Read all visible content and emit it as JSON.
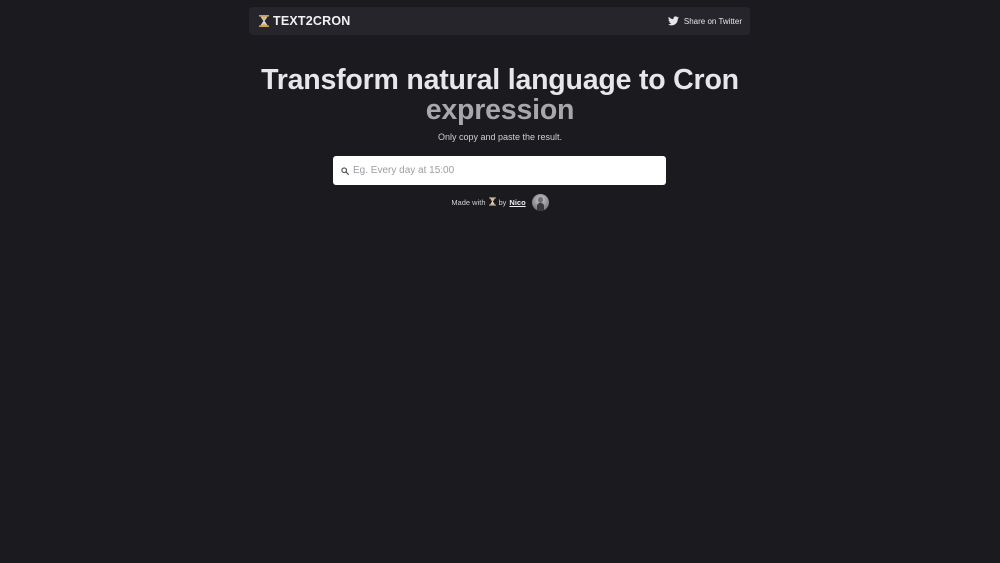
{
  "header": {
    "brand_icon": "hourglass-icon",
    "brand_name": "TEXT2CRON",
    "share_icon": "twitter-icon",
    "share_label": "Share on Twitter"
  },
  "hero": {
    "title_line1": "Transform natural language to Cron",
    "title_line2": "expression",
    "subtitle": "Only copy and paste the result."
  },
  "search": {
    "icon": "search-icon",
    "placeholder": "Eg. Every day at 15:00",
    "value": ""
  },
  "credits": {
    "made_with": "Made with",
    "icon": "hourglass-icon",
    "by": "by",
    "author": "Nico",
    "avatar": "avatar-image"
  },
  "colors": {
    "background": "#1b1a1f",
    "navbar": "#26252b",
    "title_primary": "#e7e7e9",
    "title_secondary": "#a8a8ac"
  }
}
